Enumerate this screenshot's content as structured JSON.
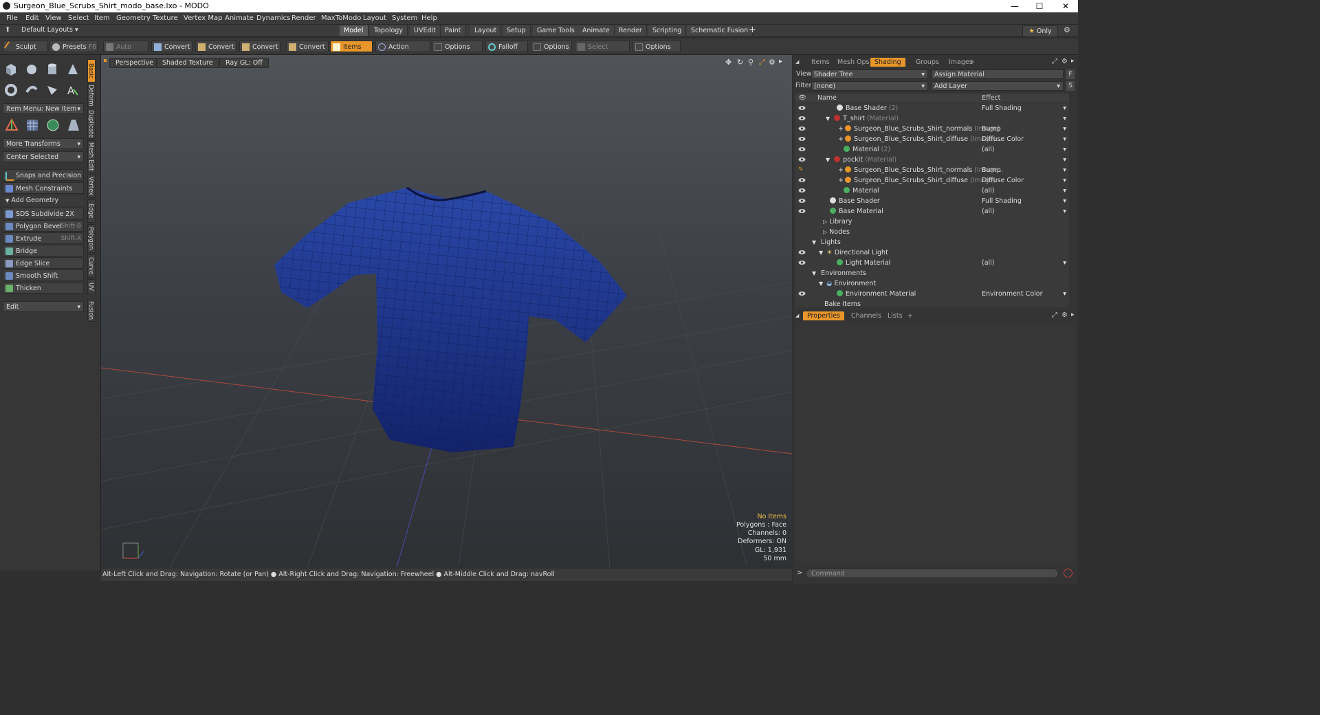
{
  "window": {
    "title": "Surgeon_Blue_Scrubs_Shirt_modo_base.lxo - MODO",
    "minimize": "—",
    "maximize": "☐",
    "close": "✕"
  },
  "menu": [
    "File",
    "Edit",
    "View",
    "Select",
    "Item",
    "Geometry",
    "Texture",
    "Vertex Map",
    "Animate",
    "Dynamics",
    "Render",
    "MaxToModo",
    "Layout",
    "System",
    "Help"
  ],
  "layout": {
    "default_layouts": "Default Layouts",
    "tabs": [
      "Model",
      "Topology",
      "UVEdit",
      "Paint",
      "Layout",
      "Setup",
      "Game Tools",
      "Animate",
      "Render",
      "Scripting",
      "Schematic Fusion"
    ],
    "active_tab": "Model",
    "add": "+",
    "only": "Only"
  },
  "toolbar": {
    "sculpt": "Sculpt",
    "presets": "Presets",
    "presets_key": "F6",
    "auto_select": "Auto Select",
    "convert1": "Convert",
    "convert2": "Convert",
    "convert3": "Convert",
    "convert4": "Convert",
    "items": "Items",
    "action_center": "Action Center",
    "options1": "Options",
    "falloff": "Falloff",
    "options2": "Options",
    "select_through": "Select Through",
    "options3": "Options"
  },
  "left_panel": {
    "item_menu": "Item Menu: New Item",
    "more_transforms": "More Transforms",
    "center_selected": "Center Selected",
    "snaps": "Snaps and Precision",
    "mesh_constraints": "Mesh Constraints",
    "add_geometry": "Add Geometry",
    "tools": [
      {
        "label": "SDS Subdivide 2X",
        "key": ""
      },
      {
        "label": "Polygon Bevel",
        "key": "Shift-B"
      },
      {
        "label": "Extrude",
        "key": "Shift-X"
      },
      {
        "label": "Bridge",
        "key": ""
      },
      {
        "label": "Edge Slice",
        "key": ""
      },
      {
        "label": "Smooth Shift",
        "key": ""
      },
      {
        "label": "Thicken",
        "key": ""
      }
    ],
    "edit": "Edit",
    "vertical_tabs": [
      "Basic",
      "Deform",
      "Duplicate",
      "Mesh Edit",
      "Vertex",
      "Edge",
      "Polygon",
      "Curve",
      "UV",
      "Fusion"
    ]
  },
  "viewport": {
    "perspective": "Perspective",
    "shaded": "Shaded Texture",
    "raygl": "Ray GL: Off",
    "info": {
      "no_items": "No Items",
      "polygons": "Polygons : Face",
      "channels": "Channels: 0",
      "deformers": "Deformers: ON",
      "gl": "GL: 1,931",
      "lens": "50 mm"
    }
  },
  "statusbar": "Alt-Left Click and Drag: Navigation: Rotate (or Pan) ● Alt-Right Click and Drag: Navigation: Freewheel ● Alt-Middle Click and Drag: navRoll",
  "right_panel": {
    "tabs": [
      "Items",
      "Mesh Ops",
      "Shading",
      "Groups",
      "Images",
      "+"
    ],
    "active_tab": "Shading",
    "view_label": "View",
    "view_value": "Shader Tree",
    "assign_material": "Assign Material",
    "filter_label": "Filter",
    "filter_value": "(none)",
    "add_layer": "Add Layer",
    "col_name": "Name",
    "col_effect": "Effect",
    "rows": [
      {
        "name": "Base Shader",
        "sub": "(2)",
        "effect": "Full Shading"
      },
      {
        "name": "T_shirt",
        "sub": "(Material)",
        "effect": ""
      },
      {
        "name": "Surgeon_Blue_Scrubs_Shirt_normals",
        "sub": "(Image)",
        "effect": "Bump"
      },
      {
        "name": "Surgeon_Blue_Scrubs_Shirt_diffuse",
        "sub": "(Image)...",
        "effect": "Diffuse Color"
      },
      {
        "name": "Material",
        "sub": "(2)",
        "effect": "(all)"
      },
      {
        "name": "pockit",
        "sub": "(Material)",
        "effect": ""
      },
      {
        "name": "Surgeon_Blue_Scrubs_Shirt_normals",
        "sub": "(Image...",
        "effect": "Bump"
      },
      {
        "name": "Surgeon_Blue_Scrubs_Shirt_diffuse",
        "sub": "(Image)",
        "effect": "Diffuse Color"
      },
      {
        "name": "Material",
        "sub": "",
        "effect": "(all)"
      },
      {
        "name": "Base Shader",
        "sub": "",
        "effect": "Full Shading"
      },
      {
        "name": "Base Material",
        "sub": "",
        "effect": "(all)"
      },
      {
        "name": "Library",
        "sub": "",
        "effect": ""
      },
      {
        "name": "Nodes",
        "sub": "",
        "effect": ""
      },
      {
        "name": "Lights",
        "sub": "",
        "effect": ""
      },
      {
        "name": "Directional Light",
        "sub": "",
        "effect": ""
      },
      {
        "name": "Light Material",
        "sub": "",
        "effect": "(all)"
      },
      {
        "name": "Environments",
        "sub": "",
        "effect": ""
      },
      {
        "name": "Environment",
        "sub": "",
        "effect": ""
      },
      {
        "name": "Environment Material",
        "sub": "",
        "effect": "Environment Color"
      },
      {
        "name": "Bake Items",
        "sub": "",
        "effect": ""
      }
    ],
    "bottom_tabs": [
      "Properties",
      "Channels",
      "Lists",
      "+"
    ],
    "command_placeholder": "Command"
  },
  "colors": {
    "accent": "#e8962a",
    "shirt": "#1f3a8a"
  }
}
